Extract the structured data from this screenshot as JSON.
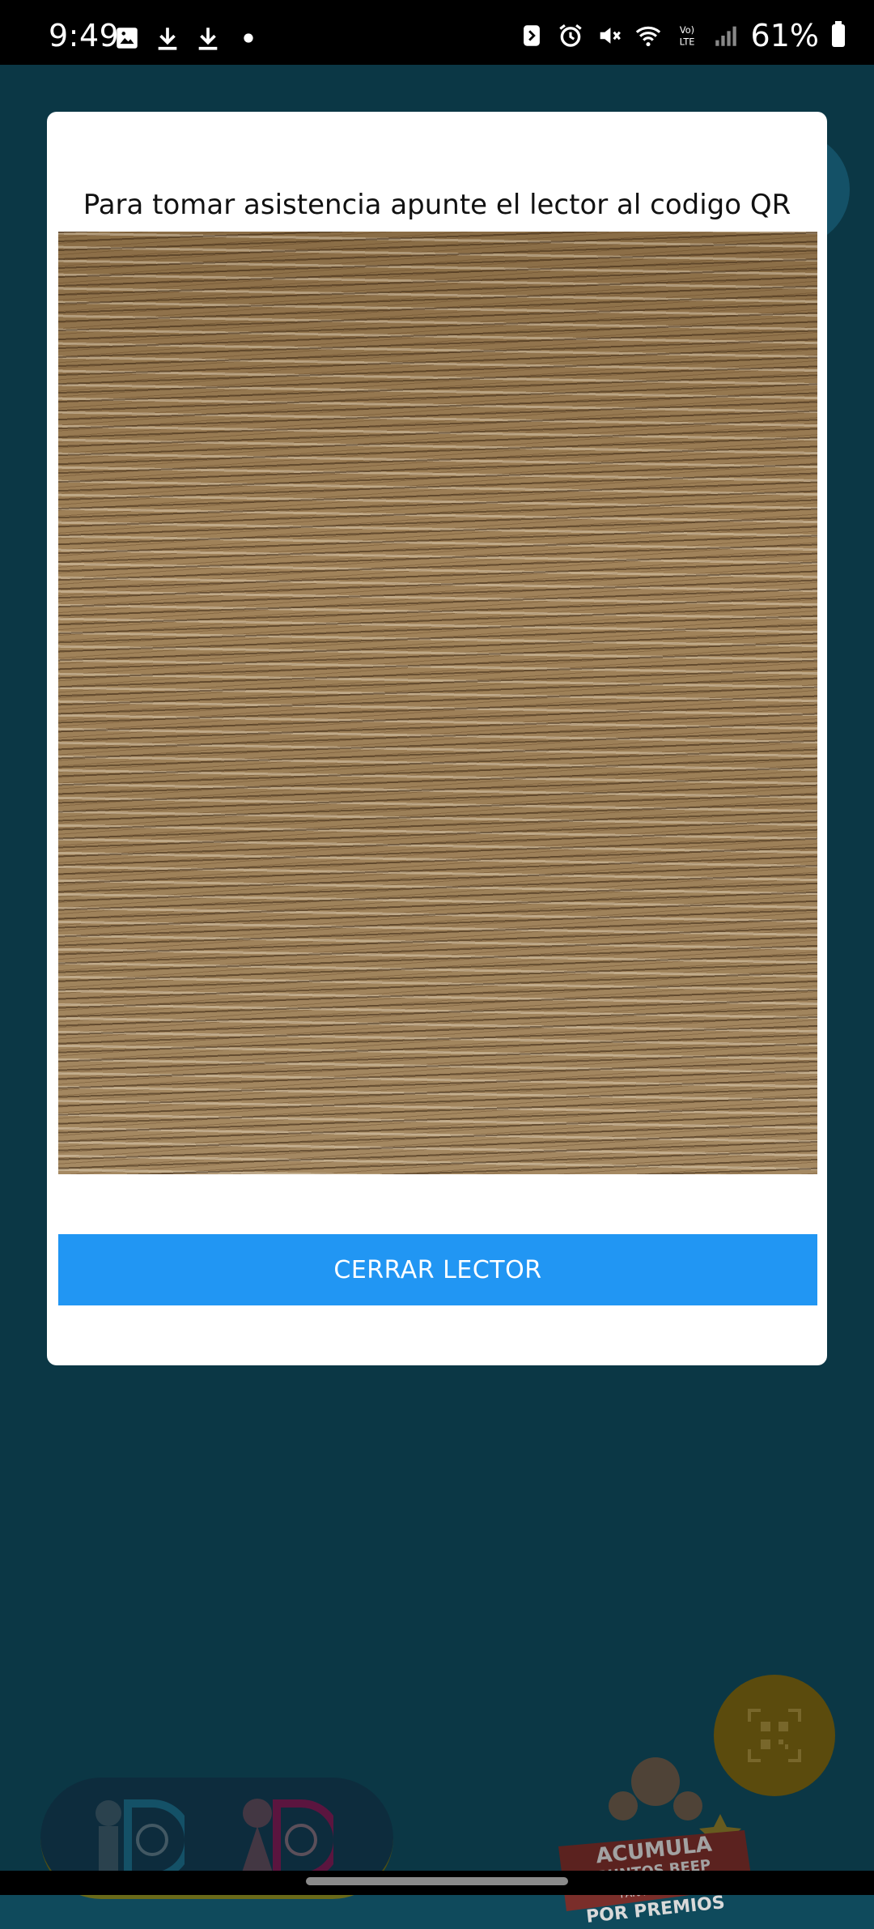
{
  "status_bar": {
    "time": "9:49",
    "battery": "61%",
    "left_icons": [
      "image-icon",
      "download-icon",
      "download-icon",
      "dot-icon"
    ],
    "right_icons": [
      "nfc-icon",
      "alarm-icon",
      "mute-icon",
      "wifi-icon",
      "volte-icon",
      "signal-icon",
      "battery-icon"
    ]
  },
  "dialog": {
    "title": "Para tomar asistencia apunte el lector al codigo QR",
    "close_button_label": "CERRAR LECTOR"
  },
  "background": {
    "promo": {
      "line1": "ACUMULA",
      "line2": "PUNTOS BEEP",
      "line3": "PARA CANJEAR",
      "line4": "POR PREMIOS"
    }
  },
  "colors": {
    "primary_button": "#2196f3",
    "background": "#0f4a5c",
    "fab": "#7a6412"
  }
}
